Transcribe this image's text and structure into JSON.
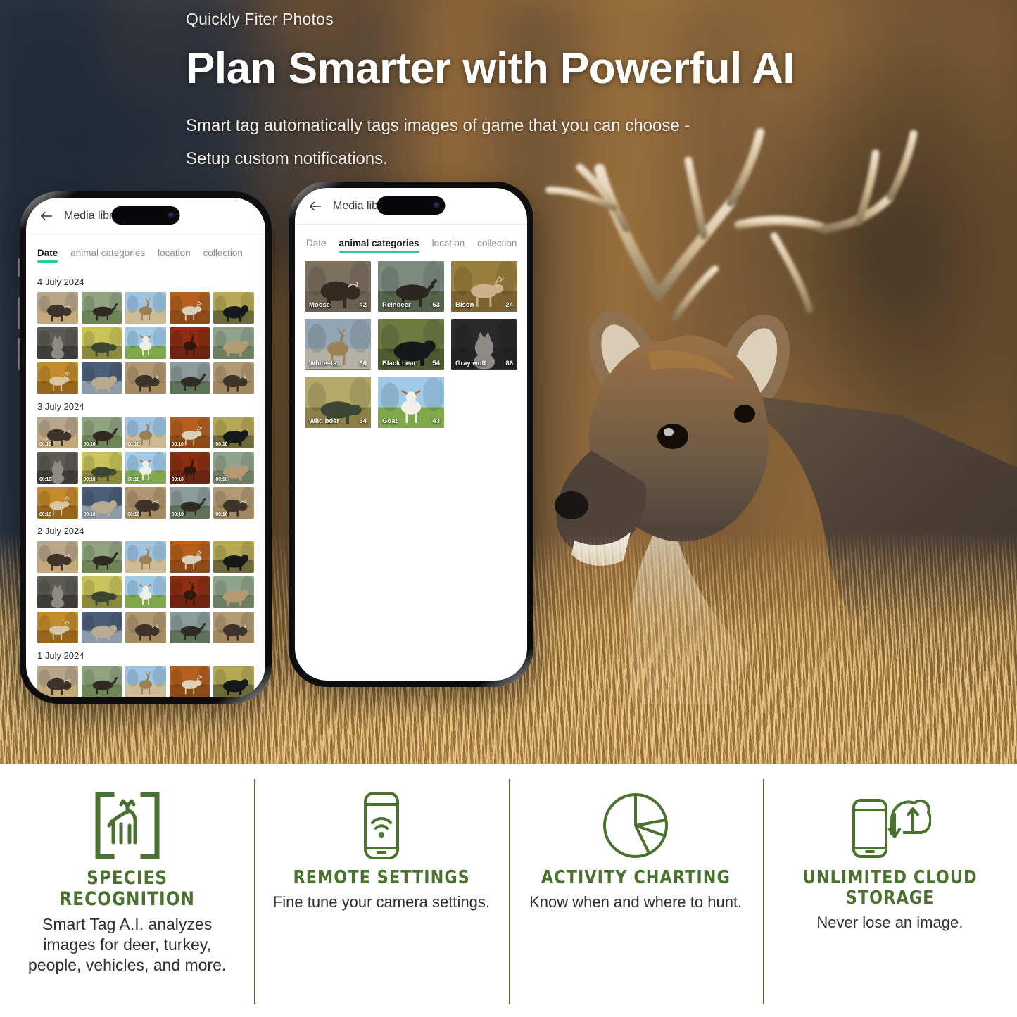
{
  "hero": {
    "eyebrow": "Quickly Fiter Photos",
    "headline": "Plan Smarter with Powerful AI",
    "subline": "Smart tag automatically tags images of game that you can choose -Setup custom notifications."
  },
  "accent_color": "#2ec98d",
  "feature_green": "#4b7131",
  "phone_a": {
    "appbar": {
      "title": "Media library",
      "back_icon": "back-arrow-icon"
    },
    "tabs": [
      {
        "label": "Date",
        "active": true
      },
      {
        "label": "animal categories",
        "active": false
      },
      {
        "label": "location",
        "active": false
      },
      {
        "label": "collection",
        "active": false
      }
    ],
    "sections": [
      {
        "date": "4 July 2024",
        "count": 15,
        "has_duration": false,
        "duration": ""
      },
      {
        "date": "3 July 2024",
        "count": 15,
        "has_duration": true,
        "duration": "00:10"
      },
      {
        "date": "2 July 2024",
        "count": 15,
        "has_duration": false,
        "duration": ""
      },
      {
        "date": "1 July 2024",
        "count": 15,
        "has_duration": false,
        "duration": ""
      }
    ]
  },
  "phone_b": {
    "appbar": {
      "title": "Media library",
      "back_icon": "back-arrow-icon"
    },
    "tabs": [
      {
        "label": "Date",
        "active": false
      },
      {
        "label": "animal categories",
        "active": true
      },
      {
        "label": "location",
        "active": false
      },
      {
        "label": "collection",
        "active": false
      }
    ],
    "categories": [
      {
        "label": "Moose",
        "count": "42",
        "scene": "moose"
      },
      {
        "label": "Reindeer",
        "count": "63",
        "scene": "reindeer"
      },
      {
        "label": "Bison",
        "count": "24",
        "scene": "bison"
      },
      {
        "label": "White–ta...",
        "count": "36",
        "scene": "whitetail"
      },
      {
        "label": "Black bear",
        "count": "54",
        "scene": "blackbear"
      },
      {
        "label": "Gray wolf",
        "count": "86",
        "scene": "wolf"
      },
      {
        "label": "Wild boar",
        "count": "64",
        "scene": "boar"
      },
      {
        "label": "Goat",
        "count": "43",
        "scene": "goat"
      }
    ]
  },
  "features": [
    {
      "icon": "deer-in-brackets-icon",
      "title": "SPECIES RECOGNITION",
      "desc": "Smart Tag A.I. analyzes images for deer, turkey, people, vehicles, and more."
    },
    {
      "icon": "phone-wifi-icon",
      "title": "REMOTE SETTINGS",
      "desc": "Fine tune your camera settings."
    },
    {
      "icon": "pie-chart-icon",
      "title": "ACTIVITY CHARTING",
      "desc": "Know when and where to hunt."
    },
    {
      "icon": "phone-cloud-sync-icon",
      "title": "UNLIMITED CLOUD STORAGE",
      "desc": "Never lose an image."
    }
  ]
}
